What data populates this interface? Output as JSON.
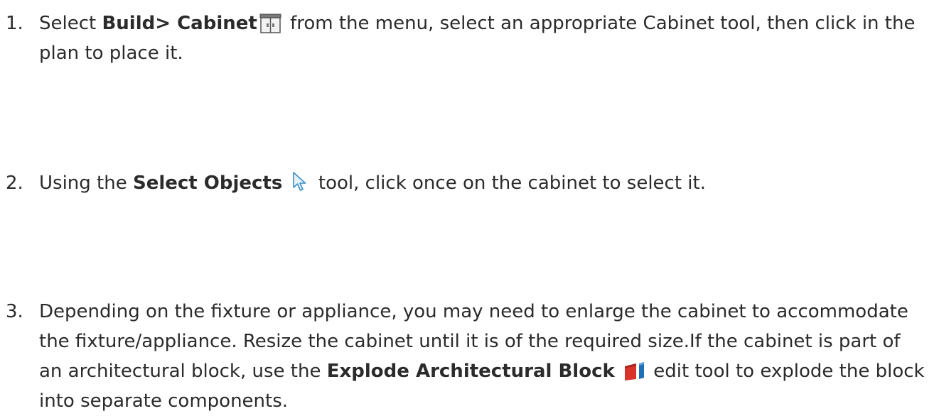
{
  "steps": [
    {
      "number": "1.",
      "pre": "Select ",
      "bold": "Build> Cabinet",
      "icon": "cabinet-icon",
      "post": " from the menu, select an appropriate Cabinet tool, then click in the plan to place it."
    },
    {
      "number": "2.",
      "pre": "Using the ",
      "bold": "Select Objects",
      "icon": "select-objects-arrow-icon",
      "post": " tool, click once on the cabinet to select it."
    },
    {
      "number": "3.",
      "pre": "Depending on the fixture or appliance, you may need to enlarge the cabinet to accommodate the fixture/appliance. Resize the cabinet until it is of the required size.If the cabinet is part of an architectural block, use the ",
      "bold": "Explode Architectural Block",
      "icon": "explode-architectural-block-icon",
      "post": " edit tool to explode the block into separate components."
    }
  ],
  "colors": {
    "text": "#2b2b2b",
    "explode_red": "#d9342b",
    "explode_blue": "#1f6fb5"
  }
}
